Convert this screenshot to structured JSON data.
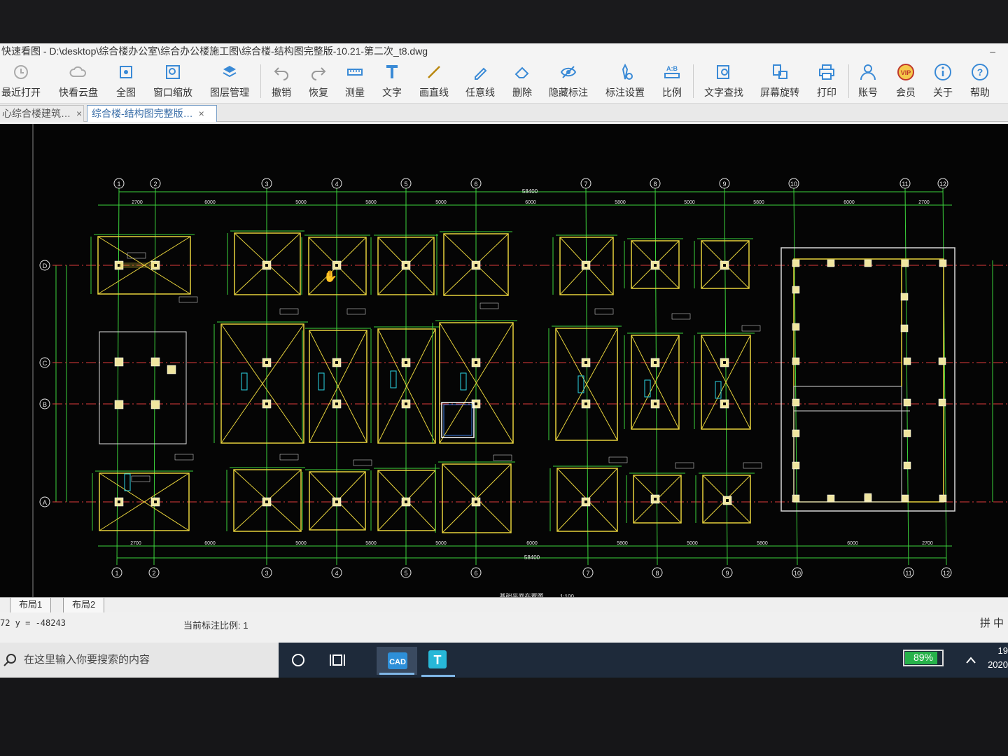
{
  "window": {
    "title": "快速看图 - D:\\desktop\\综合楼办公室\\综合办公楼施工图\\综合楼-结构图完整版-10.21-第二次_t8.dwg",
    "minimize": "–"
  },
  "toolbar": [
    {
      "label": "最近打开",
      "icon": "clock-icon"
    },
    {
      "label": "快看云盘",
      "icon": "cloud-icon"
    },
    {
      "label": "全图",
      "icon": "fullview-icon"
    },
    {
      "label": "窗口缩放",
      "icon": "zoom-window-icon"
    },
    {
      "label": "图层管理",
      "icon": "layers-icon"
    },
    {
      "label": "撤销",
      "icon": "undo-icon"
    },
    {
      "label": "恢复",
      "icon": "redo-icon"
    },
    {
      "label": "测量",
      "icon": "ruler-icon"
    },
    {
      "label": "文字",
      "icon": "text-icon"
    },
    {
      "label": "画直线",
      "icon": "line-icon"
    },
    {
      "label": "任意线",
      "icon": "freehand-icon"
    },
    {
      "label": "删除",
      "icon": "eraser-icon"
    },
    {
      "label": "隐藏标注",
      "icon": "hide-eye-icon"
    },
    {
      "label": "标注设置",
      "icon": "annotation-settings-icon"
    },
    {
      "label": "比例",
      "icon": "scale-icon"
    },
    {
      "label": "文字查找",
      "icon": "text-search-icon"
    },
    {
      "label": "屏幕旋转",
      "icon": "rotate-screen-icon"
    },
    {
      "label": "打印",
      "icon": "printer-icon"
    },
    {
      "label": "账号",
      "icon": "account-icon"
    },
    {
      "label": "会员",
      "icon": "vip-icon"
    },
    {
      "label": "关于",
      "icon": "info-icon"
    },
    {
      "label": "帮助",
      "icon": "help-icon"
    }
  ],
  "tabs": [
    {
      "label": "心综合楼建筑…",
      "close": "×"
    },
    {
      "label": "综合楼-结构图完整版…",
      "close": "×"
    }
  ],
  "drawing": {
    "axes_top": [
      "1",
      "2",
      "3",
      "4",
      "5",
      "6",
      "7",
      "8",
      "9",
      "10",
      "11",
      "12"
    ],
    "axes_left": [
      "D",
      "C",
      "B",
      "A"
    ],
    "total_dim": "58400",
    "top_dims": [
      "2700",
      "6000",
      "5000",
      "5800",
      "5000",
      "6000",
      "5800",
      "5000",
      "5800",
      "6000",
      "2700"
    ],
    "bottom_dims": [
      "2700",
      "6000",
      "5000",
      "5800",
      "5000",
      "6000",
      "5800",
      "5000",
      "5800",
      "6000",
      "2700"
    ],
    "drawing_title": "基础平面布置图",
    "drawing_scale": "1:100",
    "colors": {
      "background": "#050505",
      "grid": "#3cd43c",
      "footing": "#e6d23c",
      "axis": "#e03c3c",
      "column": "#f0e6a0",
      "wall": "#d8d8d8",
      "text": "#e8e8e8",
      "cyan": "#2ad6e6"
    }
  },
  "layout_tabs": [
    "布局1",
    "布局2"
  ],
  "status": {
    "coords": "72 y = -48243",
    "scale_label": "当前标注比例: 1",
    "ime": "拼 中"
  },
  "taskbar": {
    "search_placeholder": "在这里输入你要搜索的内容",
    "battery_percent": 89,
    "battery_label": "89%",
    "clock_time": "19",
    "clock_date": "2020"
  }
}
